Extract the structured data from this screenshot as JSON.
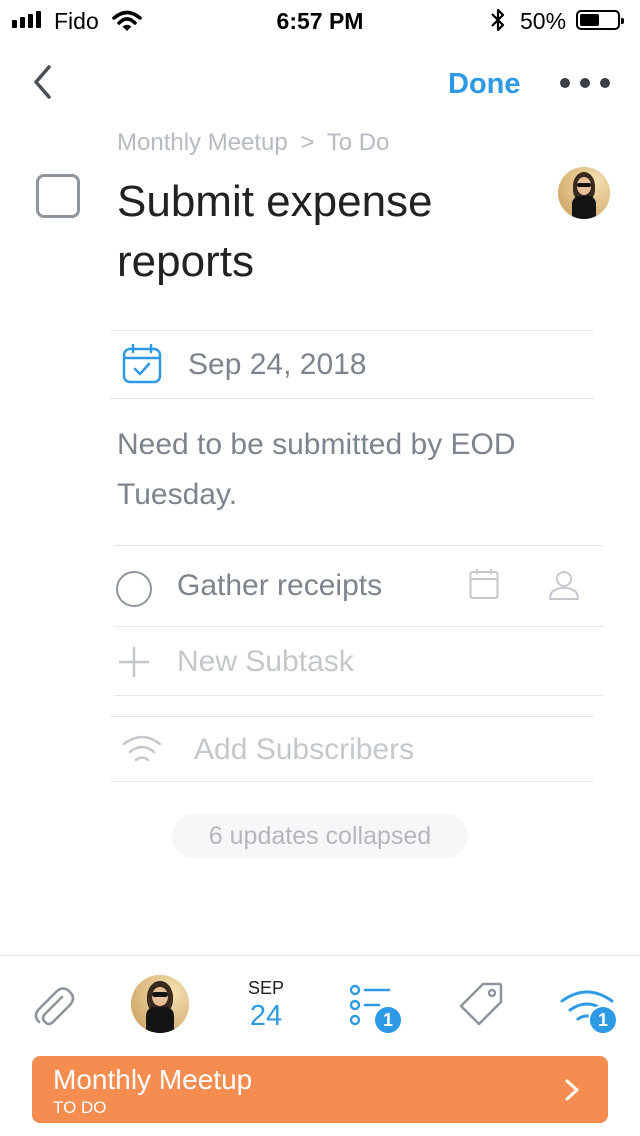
{
  "status_bar": {
    "carrier": "Fido",
    "time": "6:57 PM",
    "battery": "50%"
  },
  "nav": {
    "done_label": "Done"
  },
  "breadcrumb": {
    "project": "Monthly Meetup",
    "separator": ">",
    "section": "To Do"
  },
  "task": {
    "title": "Submit expense reports",
    "due_date": "Sep 24, 2018",
    "notes": "Need to be submitted by EOD Tuesday."
  },
  "subtasks": [
    {
      "label": "Gather receipts"
    }
  ],
  "new_subtask_placeholder": "New Subtask",
  "add_subscribers_label": "Add Subscribers",
  "updates_collapsed": "6 updates collapsed",
  "toolbar": {
    "date_month": "SEP",
    "date_day": "24",
    "checklist_badge": "1",
    "subscribers_badge": "1",
    "icons": [
      "paperclip-icon",
      "avatar",
      "date",
      "checklist-icon",
      "tag-icon",
      "subscribers-icon"
    ]
  },
  "project_bar": {
    "name": "Monthly Meetup",
    "section": "TO DO"
  },
  "colors": {
    "accent": "#2e9ae6",
    "project": "#f48d4f",
    "muted_text": "#7d848d",
    "placeholder": "#c4c8cd"
  }
}
